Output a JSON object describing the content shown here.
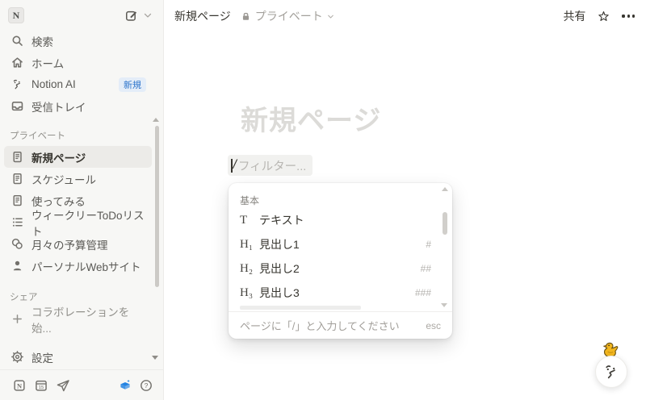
{
  "sidebar": {
    "workspace_initial": "N",
    "top_items": [
      {
        "label": "検索"
      },
      {
        "label": "ホーム"
      },
      {
        "label": "Notion AI",
        "badge": "新規"
      },
      {
        "label": "受信トレイ"
      }
    ],
    "private_section": "プライベート",
    "private_items": [
      {
        "label": "新規ページ"
      },
      {
        "label": "スケジュール"
      },
      {
        "label": "使ってみる"
      },
      {
        "label": "ウィークリーToDoリスト"
      },
      {
        "label": "月々の予算管理"
      },
      {
        "label": "パーソナルWebサイト"
      }
    ],
    "share_section": "シェア",
    "share_new_label": "コラボレーションを始...",
    "settings_label": "設定"
  },
  "topbar": {
    "breadcrumb_title": "新規ページ",
    "privacy_label": "プライベート",
    "share_label": "共有"
  },
  "main": {
    "title_placeholder": "新規ページ",
    "slash_char": "/",
    "slash_placeholder": "フィルター..."
  },
  "slash_menu": {
    "section_label": "基本",
    "items": [
      {
        "icon": "T",
        "label": "テキスト",
        "shortcut": ""
      },
      {
        "icon": "H₁",
        "label": "見出し1",
        "shortcut": "#"
      },
      {
        "icon": "H₂",
        "label": "見出し2",
        "shortcut": "##"
      },
      {
        "icon": "H₃",
        "label": "見出し3",
        "shortcut": "###"
      }
    ],
    "footer_hint": "ページに「/」と入力してください",
    "footer_esc": "esc"
  },
  "colors": {
    "accent_blue": "#2383E2",
    "badge_bg": "#E4EDF8",
    "badge_text": "#2E75CC",
    "sidebar_bg": "#F7F7F5",
    "selected_item_bg": "#ECEBE8",
    "title_placeholder": "#DCDBD8",
    "duck_yellow": "#F2B61E"
  }
}
